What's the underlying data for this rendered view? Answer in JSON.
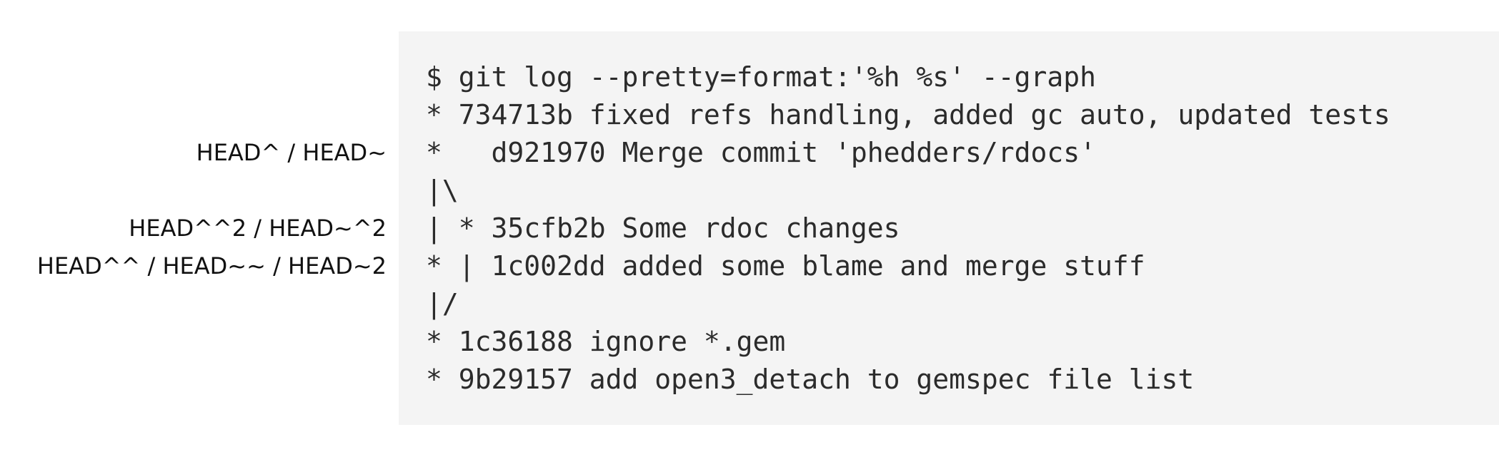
{
  "terminal": {
    "lines": [
      "$ git log --pretty=format:'%h %s' --graph",
      "* 734713b fixed refs handling, added gc auto, updated tests",
      "*   d921970 Merge commit 'phedders/rdocs'",
      "|\\",
      "| * 35cfb2b Some rdoc changes",
      "* | 1c002dd added some blame and merge stuff",
      "|/",
      "* 1c36188 ignore *.gem",
      "* 9b29157 add open3_detach to gemspec file list"
    ]
  },
  "annotations": {
    "parent_1": "HEAD^ / HEAD~",
    "parent_2": "HEAD^^2 / HEAD~^2",
    "grandparent": "HEAD^^ / HEAD~~ / HEAD~2"
  }
}
